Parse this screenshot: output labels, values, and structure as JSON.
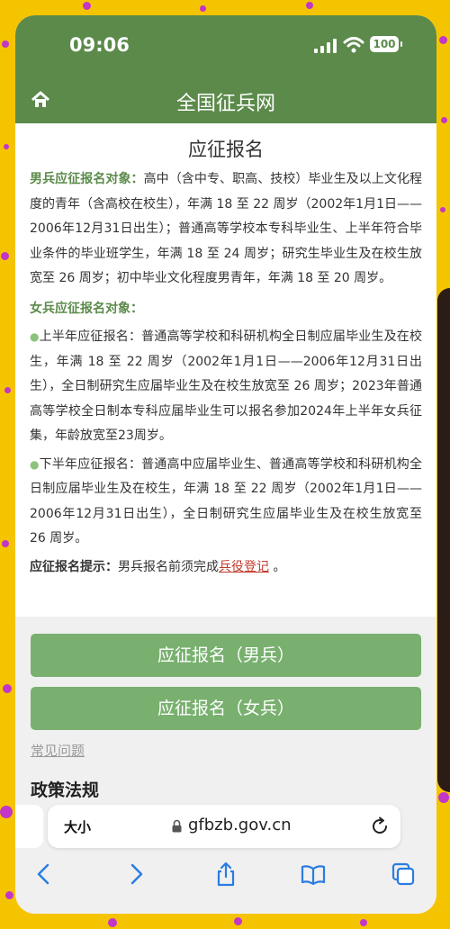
{
  "status_bar": {
    "time": "09:06",
    "battery": "100"
  },
  "nav": {
    "site_title": "全国征兵网"
  },
  "page": {
    "heading": "应征报名",
    "male": {
      "label": "男兵应征报名对象：",
      "text": "高中（含中专、职高、技校）毕业生及以上文化程度的青年（含高校在校生），年满 18 至 22 周岁（2002年1月1日——2006年12月31日出生）；普通高等学校本专科毕业生、上半年符合毕业条件的毕业班学生，年满 18 至 24 周岁；研究生毕业生及在校生放宽至 26 周岁；初中毕业文化程度男青年，年满 18 至 20 周岁。"
    },
    "female": {
      "label": "女兵应征报名对象：",
      "first_half": "上半年应征报名：普通高等学校和科研机构全日制应届毕业生及在校生，年满 18 至 22 周岁（2002年1月1日——2006年12月31日出生），全日制研究生应届毕业生及在校生放宽至 26 周岁；2023年普通高等学校全日制本专科应届毕业生可以报名参加2024年上半年女兵征集，年龄放宽至23周岁。",
      "second_half": "下半年应征报名：普通高中应届毕业生、普通高等学校和科研机构全日制应届毕业生及在校生，年满 18 至 22 周岁（2002年1月1日——2006年12月31日出生），全日制研究生应届毕业生及在校生放宽至 26 周岁。"
    },
    "hint": {
      "label": "应征报名提示：",
      "text": "男兵报名前须完成",
      "link": "兵役登记",
      "end": " 。"
    }
  },
  "buttons": {
    "male": "应征报名（男兵）",
    "female": "应征报名（女兵）"
  },
  "links": {
    "faq": "常见问题"
  },
  "section": {
    "policy": "政策法规"
  },
  "browser": {
    "text_size": "大小",
    "url": "gfbzb.gov.cn"
  },
  "colors": {
    "header_green": "#5b8a4a",
    "button_green": "#79b06f",
    "frame_yellow": "#f5c400",
    "link_red": "#c0392b"
  }
}
